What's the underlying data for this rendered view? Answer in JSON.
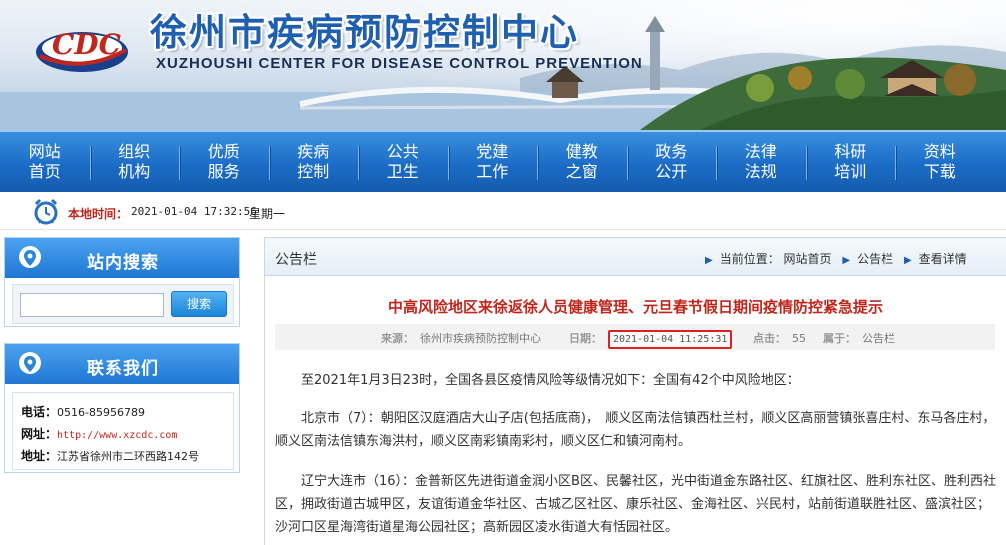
{
  "header": {
    "title": "徐州市疾病预防控制中心",
    "subtitle": "XUZHOUSHI CENTER FOR DISEASE CONTROL PREVENTION",
    "logo_text": "CDC",
    "logo_icon": "cdc-logo-icon"
  },
  "nav": {
    "items": [
      {
        "label": "网站首页"
      },
      {
        "label": "组织机构"
      },
      {
        "label": "优质服务"
      },
      {
        "label": "疾病控制"
      },
      {
        "label": "公共卫生"
      },
      {
        "label": "党建工作"
      },
      {
        "label": "健教之窗"
      },
      {
        "label": "政务公开"
      },
      {
        "label": "法律法规"
      },
      {
        "label": "科研培训"
      },
      {
        "label": "资料下载"
      }
    ]
  },
  "timebar": {
    "icon": "alarm-clock-icon",
    "label": "本地时间：",
    "datetime": "2021-01-04 17:32:56",
    "weekday": "星期一"
  },
  "sidebar": {
    "search": {
      "title": "站内搜索",
      "placeholder": "",
      "value": "",
      "button_label": "搜索",
      "icon": "location-pin-icon"
    },
    "contact": {
      "title": "联系我们",
      "icon": "location-pin-icon",
      "phone_label": "电话：",
      "phone": "0516-85956789",
      "url_label": "网址：",
      "url": "http://www.xzcdc.com",
      "address_label": "地址：",
      "address": "江苏省徐州市二环西路142号"
    }
  },
  "main": {
    "section_label": "公告栏",
    "breadcrumb": {
      "prefix": "当前位置：",
      "items": [
        "网站首页",
        "公告栏",
        "查看详情"
      ]
    },
    "article": {
      "title": "中高风险地区来徐返徐人员健康管理、元旦春节假日期间疫情防控紧急提示",
      "meta": {
        "source_label": "来源：",
        "source": "徐州市疾病预防控制中心",
        "date_label": "日期：",
        "date": "2021-01-04 11:25:31",
        "clicks_label": "点击：",
        "clicks": "55",
        "category_label": "属于：",
        "category": "公告栏"
      },
      "paragraphs": [
        "至2021年1月3日23时，全国各县区疫情风险等级情况如下：全国有42个中风险地区：",
        "北京市（7）：朝阳区汉庭酒店大山子店(包括底商)，　顺义区南法信镇西杜兰村，顺义区高丽营镇张喜庄村、东马各庄村，顺义区南法信镇东海洪村，顺义区南彩镇南彩村，顺义区仁和镇河南村。",
        "辽宁大连市（16）：金普新区先进街道金润小区B区、民馨社区，光中街道金东路社区、红旗社区、胜利东社区、胜利西社区，拥政街道古城甲区，友谊街道金华社区、古城乙区社区、康乐社区、金海社区、兴民村，站前街道联胜社区、盛滨社区；沙河口区星海湾街道星海公园社区；高新园区凌水街道大有恬园社区。"
      ]
    }
  },
  "colors": {
    "nav_blue": "#1b6cc6",
    "title_red": "#c0261c",
    "highlight_border": "#e02020"
  }
}
